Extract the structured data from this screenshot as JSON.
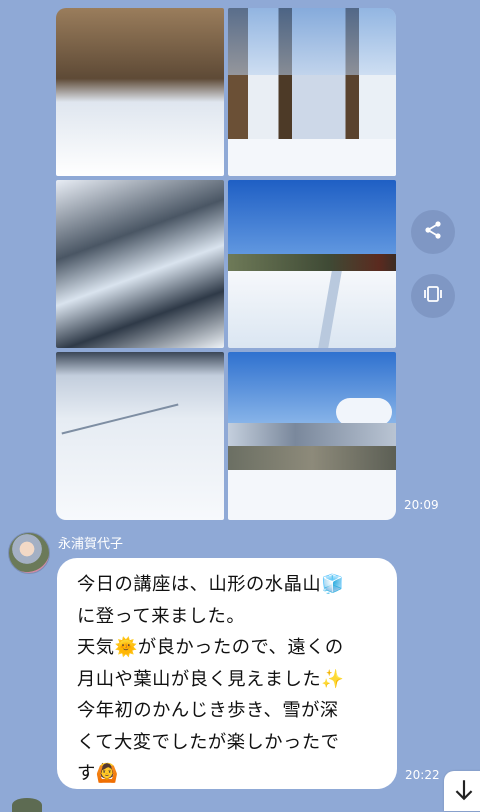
{
  "photo_message": {
    "time": "20:09",
    "photos": [
      {
        "description": "snow-shrine-group"
      },
      {
        "description": "snow-forest-hiker"
      },
      {
        "description": "snowy-trees"
      },
      {
        "description": "snow-field-trail"
      },
      {
        "description": "snow-ground"
      },
      {
        "description": "snow-mountain-view"
      }
    ]
  },
  "actions": {
    "share_icon": "share-icon",
    "keep_icon": "keep-icon"
  },
  "text_message": {
    "sender": "永浦賀代子",
    "lines": [
      "今日の講座は、山形の水晶山🧊",
      "に登って来ました。",
      "天気🌞が良かったので、遠くの",
      "月山や葉山が良く見えました✨",
      "今年初のかんじき歩き、雪が深",
      "くて大変でしたが楽しかったで",
      "す🙆"
    ],
    "time": "20:22"
  },
  "scroll": {
    "icon": "arrow-down-icon"
  }
}
